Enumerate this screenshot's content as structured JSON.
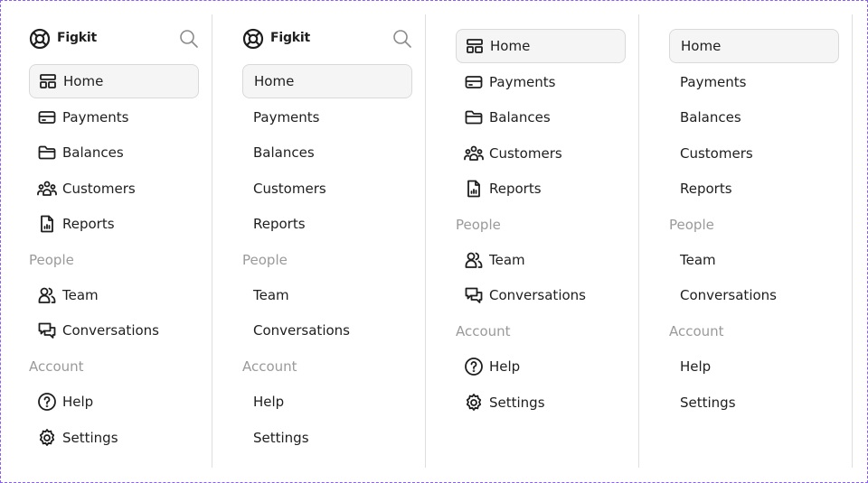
{
  "brand": {
    "name": "Figkit"
  },
  "labels": {
    "home": "Home",
    "payments": "Payments",
    "balances": "Balances",
    "customers": "Customers",
    "reports": "Reports",
    "people": "People",
    "team": "Team",
    "conversations": "Conversations",
    "account": "Account",
    "help": "Help",
    "settings": "Settings"
  },
  "variants": [
    {
      "header": true,
      "icons": true,
      "active": "Home"
    },
    {
      "header": true,
      "icons": false,
      "active": "Home"
    },
    {
      "header": false,
      "icons": true,
      "active": "Home"
    },
    {
      "header": false,
      "icons": false,
      "active": "Home"
    }
  ],
  "colors": {
    "frame_border": "#8b5cf6",
    "active_bg": "#f5f5f5",
    "section_text": "#9a9a9a",
    "text": "#1e1e1e"
  },
  "icons": {
    "brand": "lifebuoy-icon",
    "search": "search-icon",
    "home": "layout-icon",
    "payments": "credit-card-icon",
    "balances": "folder-icon",
    "customers": "users-group-icon",
    "reports": "report-file-icon",
    "team": "users-icon",
    "conversations": "chat-bubbles-icon",
    "help": "help-circle-icon",
    "settings": "settings-gear-icon"
  }
}
